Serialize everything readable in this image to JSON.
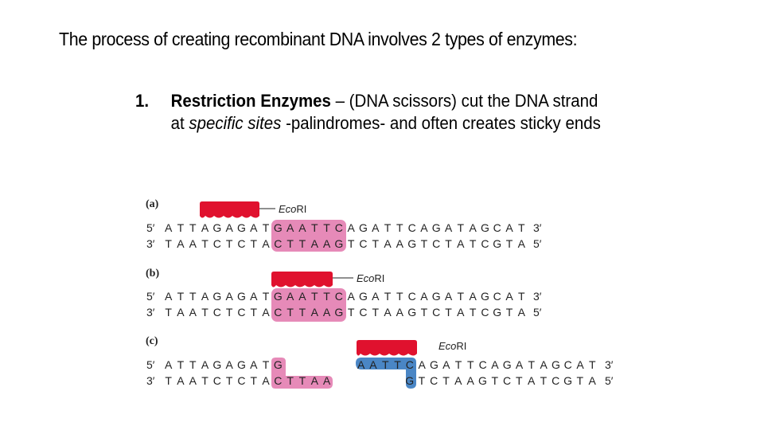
{
  "slide": {
    "title": "The process of creating recombinant DNA involves 2 types of enzymes:",
    "list_item": {
      "number": "1.",
      "term": "Restriction Enzymes",
      "dash": " – ",
      "text_1": "(DNA scissors) cut the DNA strand at ",
      "emphasis": "specific sites",
      "text_2": " -palindromes- and often creates sticky ends"
    }
  },
  "figure": {
    "enzyme_italic": "Eco",
    "enzyme_rest": "RI",
    "colors": {
      "enzyme": "#e0112e",
      "site_pink": "#e68ab8",
      "sticky_blue": "#4a86c5"
    },
    "panels": [
      {
        "label": "(a)",
        "top_strand": {
          "five": "5′",
          "seq": "ATTAGAGATGAATTCAGATTCAGATAGCAT",
          "three": "3′"
        },
        "bottom_strand": {
          "three": "3′",
          "seq": "TAATCTCTACTTAAGTCTAAGTCTATCGTA",
          "five": "5′"
        }
      },
      {
        "label": "(b)",
        "top_strand": {
          "five": "5′",
          "seq": "ATTAGAGATGAATTCAGATTCAGATAGCAT",
          "three": "3′"
        },
        "bottom_strand": {
          "three": "3′",
          "seq": "TAATCTCTACTTAAGTCTAAGTCTATCGTA",
          "five": "5′"
        }
      },
      {
        "label": "(c)",
        "left_fragment": {
          "top_strand": {
            "five": "5′",
            "seq": "ATTAGAGATG"
          },
          "bottom_strand": {
            "three": "3′",
            "seq": "TAATCTCTACTTAA"
          }
        },
        "right_fragment": {
          "top_strand": {
            "seq": "AATTCAGATTCAGATAGCAT",
            "three": "3′"
          },
          "bottom_strand": {
            "seq": "GTCTAAGTCTATCGTA",
            "five": "5′"
          }
        }
      }
    ]
  }
}
